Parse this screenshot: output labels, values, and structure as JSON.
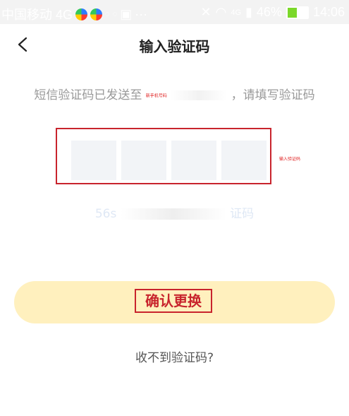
{
  "status_bar": {
    "carrier": "中国移动 4G",
    "bluetooth": "≈",
    "battery": "46%",
    "time": "14:06",
    "network": "4G"
  },
  "header": {
    "title": "输入验证码"
  },
  "hint": {
    "prefix": "短信验证码已发送至",
    "phone_annotation": "新手机号码",
    "suffix": "，请填写验证码"
  },
  "code": {
    "annotation": "输入验证码"
  },
  "countdown": {
    "seconds": "56s",
    "suffix": "证码"
  },
  "confirm": {
    "label": "确认更换"
  },
  "resend": {
    "label": "收不到验证码?"
  },
  "colors": {
    "accent": "#fff0be",
    "annotation": "#c8242d",
    "hint_text": "#999999"
  }
}
